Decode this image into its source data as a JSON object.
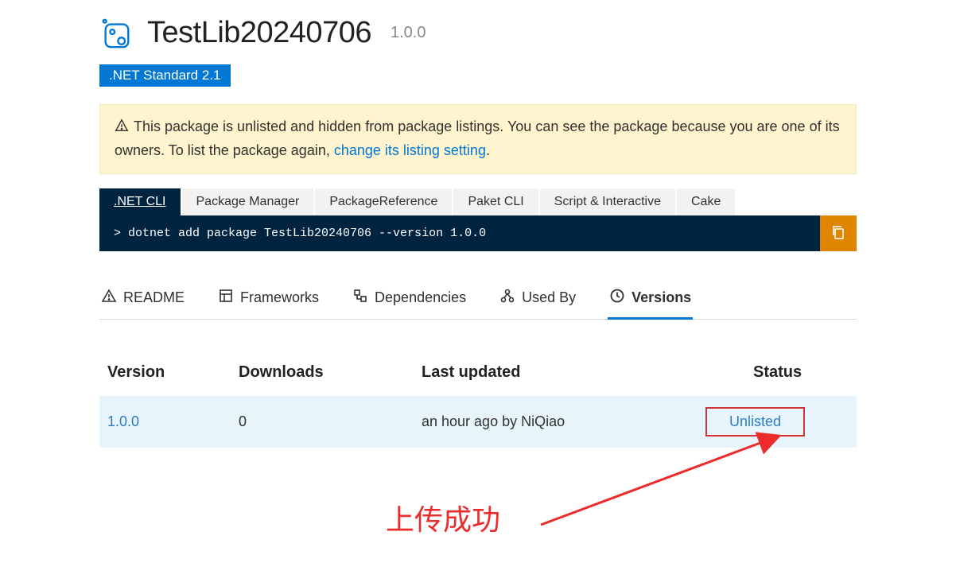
{
  "package": {
    "name": "TestLib20240706",
    "version": "1.0.0"
  },
  "framework_badge": ".NET Standard 2.1",
  "alert": {
    "text_prefix": "This package is unlisted and hidden from package listings. You can see the package because you are one of its owners. To list the package again, ",
    "link_text": "change its listing setting",
    "text_suffix": "."
  },
  "cmd_tabs": [
    ".NET CLI",
    "Package Manager",
    "PackageReference",
    "Paket CLI",
    "Script & Interactive",
    "Cake"
  ],
  "cmd_line": "> dotnet add package TestLib20240706 --version 1.0.0",
  "section_tabs": [
    "README",
    "Frameworks",
    "Dependencies",
    "Used By",
    "Versions"
  ],
  "versions": {
    "headers": [
      "Version",
      "Downloads",
      "Last updated",
      "Status"
    ],
    "rows": [
      {
        "version": "1.0.0",
        "downloads": "0",
        "updated": "an hour ago by NiQiao",
        "status": "Unlisted"
      }
    ]
  },
  "annotation": "上传成功"
}
